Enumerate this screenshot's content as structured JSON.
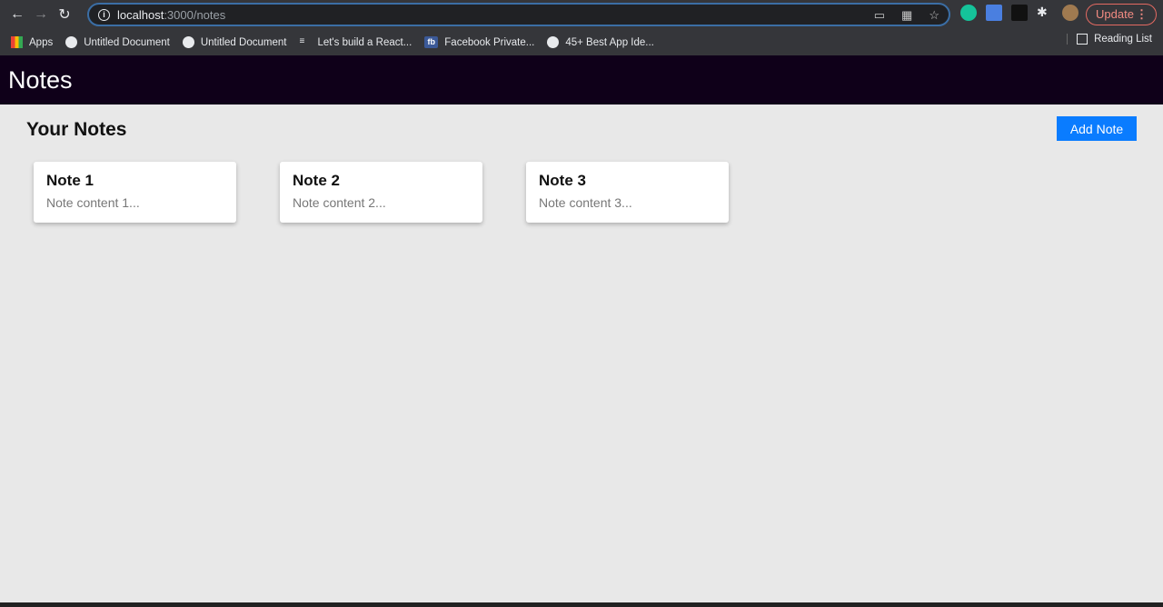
{
  "browser": {
    "url_host": "localhost",
    "url_path": ":3000/notes",
    "update_label": "Update",
    "bookmarks": [
      {
        "label": "Apps",
        "icon": "apps-grid-icon"
      },
      {
        "label": "Untitled Document",
        "icon": "globe-icon"
      },
      {
        "label": "Untitled Document",
        "icon": "globe-icon"
      },
      {
        "label": "Let's build a React...",
        "icon": "list-icon"
      },
      {
        "label": "Facebook Private...",
        "icon": "facebook-icon"
      },
      {
        "label": "45+ Best App Ide...",
        "icon": "globe-icon"
      }
    ],
    "reading_list": "Reading List"
  },
  "app": {
    "title": "Notes"
  },
  "main": {
    "heading": "Your Notes",
    "add_button": "Add Note",
    "notes": [
      {
        "title": "Note 1",
        "content": "Note content 1..."
      },
      {
        "title": "Note 2",
        "content": "Note content 2..."
      },
      {
        "title": "Note 3",
        "content": "Note content 3..."
      }
    ]
  },
  "colors": {
    "appbar": "#0f0019",
    "accent": "#0a7cff",
    "background": "#e8e8e8"
  }
}
